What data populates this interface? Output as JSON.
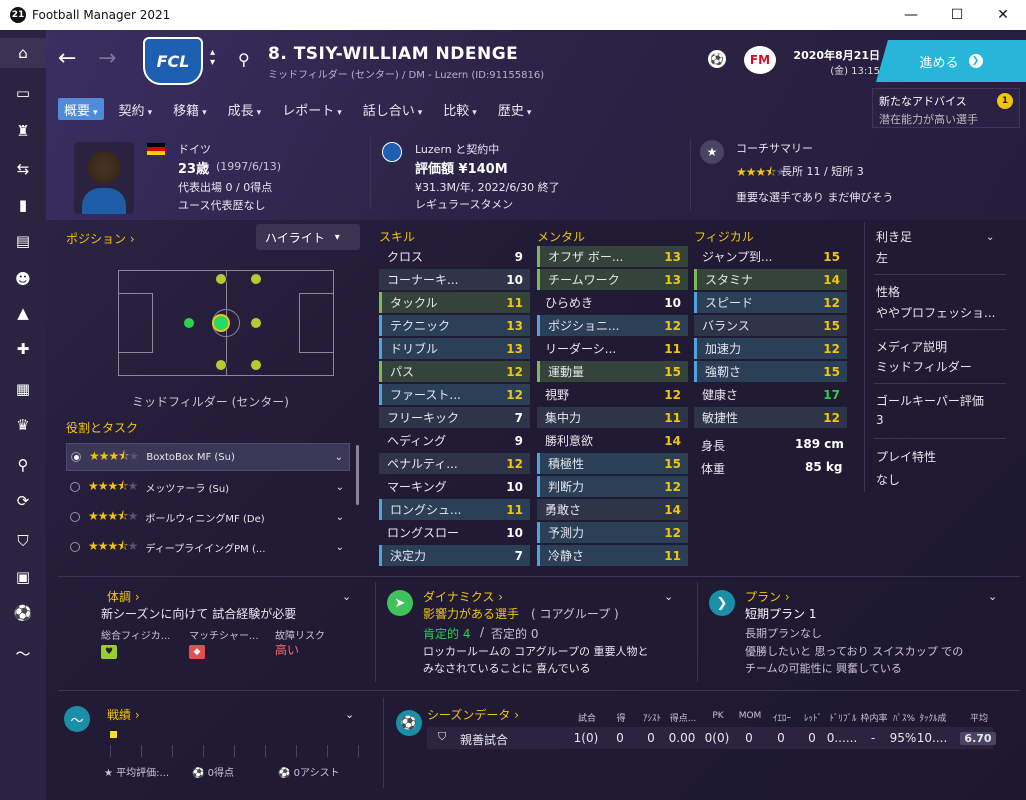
{
  "window": {
    "title": "Football Manager 2021",
    "icon_text": "21",
    "minimize": "—",
    "maximize": "☐",
    "close": "✕"
  },
  "sidebar": {
    "icons": [
      "home-icon",
      "inbox-icon",
      "squad-icon",
      "tactics-icon",
      "staff-icon",
      "training-icon",
      "scouting-icon",
      "dynamics-icon",
      "medical-icon",
      "schedule-icon",
      "trophy-icon",
      "search-icon",
      "transfers-icon",
      "club-info-icon",
      "finances-icon",
      "league-icon",
      "chart-icon"
    ]
  },
  "header": {
    "back": "←",
    "forward": "→",
    "club_crest": "FCL",
    "player_name": "8. TSIY-WILLIAM NDENGE",
    "player_sub": "ミッドフィルダー (センター) / DM - Luzern (ID:91155816)",
    "date_line1": "2020年8月21日",
    "date_line2": "(金) 13:15",
    "continue_label": "進める",
    "fm_logo": "FM"
  },
  "tabs": [
    {
      "label": "概要"
    },
    {
      "label": "契約"
    },
    {
      "label": "移籍"
    },
    {
      "label": "成長"
    },
    {
      "label": "レポート"
    },
    {
      "label": "話し合い"
    },
    {
      "label": "比較"
    },
    {
      "label": "歴史"
    }
  ],
  "advice": {
    "title": "新たなアドバイス",
    "text": "潜在能力が高い選手",
    "count": "1"
  },
  "bio": {
    "nationality": "ドイツ",
    "age": "23歳",
    "birth": "(1997/6/13)",
    "caps": "代表出場 0 / 0得点",
    "youth": "ユース代表歴なし"
  },
  "contract": {
    "club_line": "Luzern と契約中",
    "value": "評価額 ¥140M",
    "wage": "¥31.3M/年, 2022/6/30 終了",
    "status": "レギュラースタメン"
  },
  "coach": {
    "title": "コーチサマリー",
    "strengths": "長所 11 / 短所 3",
    "comment": "重要な選手であり まだ伸びそう",
    "stars": 3.5
  },
  "position": {
    "title": "ポジション",
    "highlight": "ハイライト",
    "caption": "ミッドフィルダー (センター)"
  },
  "roles": {
    "title": "役割とタスク",
    "items": [
      {
        "name": "BoxtoBox MF (Su)",
        "stars": 3.5,
        "selected": true
      },
      {
        "name": "メッツァーラ (Su)",
        "stars": 3.5,
        "selected": false
      },
      {
        "name": "ボールウィニングMF (De)",
        "stars": 3.5,
        "selected": false
      },
      {
        "name": "ディープライイングPM (...",
        "stars": 3.5,
        "selected": false
      }
    ]
  },
  "skills": {
    "title": "スキル",
    "items": [
      {
        "name": "クロス",
        "value": "9",
        "hl": "",
        "color": "white"
      },
      {
        "name": "コーナーキ...",
        "value": "10",
        "hl": "",
        "color": "white"
      },
      {
        "name": "タックル",
        "value": "11",
        "hl": "green",
        "color": "yellow"
      },
      {
        "name": "テクニック",
        "value": "13",
        "hl": "blue",
        "color": "yellow"
      },
      {
        "name": "ドリブル",
        "value": "13",
        "hl": "blue",
        "color": "yellow"
      },
      {
        "name": "パス",
        "value": "12",
        "hl": "green",
        "color": "yellow"
      },
      {
        "name": "ファースト...",
        "value": "12",
        "hl": "blue",
        "color": "yellow"
      },
      {
        "name": "フリーキック",
        "value": "7",
        "hl": "",
        "color": "white"
      },
      {
        "name": "ヘディング",
        "value": "9",
        "hl": "",
        "color": "white"
      },
      {
        "name": "ペナルティ...",
        "value": "12",
        "hl": "",
        "color": "yellow"
      },
      {
        "name": "マーキング",
        "value": "10",
        "hl": "",
        "color": "white"
      },
      {
        "name": "ロングシュ...",
        "value": "11",
        "hl": "blue",
        "color": "yellow"
      },
      {
        "name": "ロングスロー",
        "value": "10",
        "hl": "",
        "color": "white"
      },
      {
        "name": "決定力",
        "value": "7",
        "hl": "blue",
        "color": "white"
      }
    ]
  },
  "mental": {
    "title": "メンタル",
    "items": [
      {
        "name": "オフザ ボー...",
        "value": "13",
        "hl": "green",
        "color": "yellow"
      },
      {
        "name": "チームワーク",
        "value": "13",
        "hl": "green",
        "color": "yellow"
      },
      {
        "name": "ひらめき",
        "value": "10",
        "hl": "",
        "color": "white"
      },
      {
        "name": "ポジショニ...",
        "value": "12",
        "hl": "blue",
        "color": "yellow"
      },
      {
        "name": "リーダーシ...",
        "value": "11",
        "hl": "",
        "color": "yellow"
      },
      {
        "name": "運動量",
        "value": "15",
        "hl": "green",
        "color": "yellow"
      },
      {
        "name": "視野",
        "value": "12",
        "hl": "",
        "color": "yellow"
      },
      {
        "name": "集中力",
        "value": "11",
        "hl": "",
        "color": "yellow"
      },
      {
        "name": "勝利意欲",
        "value": "14",
        "hl": "",
        "color": "yellow"
      },
      {
        "name": "積極性",
        "value": "15",
        "hl": "blue",
        "color": "yellow"
      },
      {
        "name": "判断力",
        "value": "12",
        "hl": "blue",
        "color": "yellow"
      },
      {
        "name": "勇敢さ",
        "value": "14",
        "hl": "",
        "color": "yellow"
      },
      {
        "name": "予測力",
        "value": "12",
        "hl": "blue",
        "color": "yellow"
      },
      {
        "name": "冷静さ",
        "value": "11",
        "hl": "blue",
        "color": "yellow"
      }
    ]
  },
  "physical": {
    "title": "フィジカル",
    "items": [
      {
        "name": "ジャンプ到...",
        "value": "15",
        "hl": "",
        "color": "yellow"
      },
      {
        "name": "スタミナ",
        "value": "14",
        "hl": "green",
        "color": "yellow"
      },
      {
        "name": "スピード",
        "value": "12",
        "hl": "blue",
        "color": "yellow"
      },
      {
        "name": "バランス",
        "value": "15",
        "hl": "",
        "color": "yellow"
      },
      {
        "name": "加速力",
        "value": "12",
        "hl": "blue",
        "color": "yellow"
      },
      {
        "name": "強靭さ",
        "value": "15",
        "hl": "blue",
        "color": "yellow"
      },
      {
        "name": "健康さ",
        "value": "17",
        "hl": "",
        "color": "green"
      },
      {
        "name": "敏捷性",
        "value": "12",
        "hl": "",
        "color": "yellow"
      }
    ],
    "height_label": "身長",
    "height": "189 cm",
    "weight_label": "体重",
    "weight": "85 kg"
  },
  "info": {
    "foot_label": "利き足",
    "foot": "左",
    "personality_label": "性格",
    "personality": "ややプロフェッショ...",
    "media_label": "メディア説明",
    "media": "ミッドフィルダー",
    "gk_label": "ゴールキーパー評価",
    "gk": "3",
    "traits_label": "プレイ特性",
    "traits": "なし"
  },
  "condition": {
    "title": "体調",
    "text": "新シーズンに向けて 試合経験が必要",
    "col1": "総合フィジカ...",
    "col2": "マッチシャー...",
    "col3": "故障リスク",
    "risk": "高い"
  },
  "dynamics": {
    "title": "ダイナミクス",
    "line1": "影響力がある選手",
    "line1b": "( コアグループ )",
    "pos": "肯定的 4",
    "neg": "否定的 0",
    "text1": "ロッカールームの コアグループの 重要人物と",
    "text2": "みなされていることに 喜んでいる"
  },
  "plan": {
    "title": "プラン",
    "short": "短期プラン 1",
    "long": "長期プランなし",
    "text1": "優勝したいと 思っており スイスカップ での",
    "text2": "チームの可能性に 興奮している"
  },
  "form": {
    "title": "戦績",
    "avg": "平均評価:...",
    "goals": "0得点",
    "assists": "0アシスト"
  },
  "season": {
    "title": "シーズンデータ",
    "headers": [
      "試合",
      "得",
      "ｱｼｽﾄ",
      "得点...",
      "PK",
      "MOM",
      "ｲｴﾛｰ",
      "ﾚｯﾄﾞ",
      "ﾄﾞﾘﾌﾞﾙ",
      "枠内率",
      "ﾊﾟｽ%",
      "ﾀｯｸﾙ成",
      "平均"
    ],
    "row_label": "親善試合",
    "values": [
      "1(0)",
      "0",
      "0",
      "0.00",
      "0(0)",
      "0",
      "0",
      "0",
      "0......",
      "-",
      "95%",
      "10....",
      "6.70"
    ]
  },
  "colors": {
    "accent": "#27b5d9",
    "highlight_blue": "#4fa3e0",
    "star": "#f1c40f",
    "good": "#2ad14e"
  }
}
